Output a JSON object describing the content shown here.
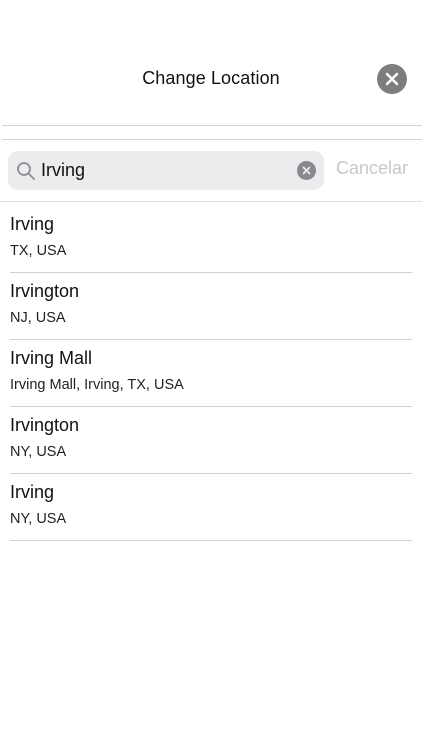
{
  "header": {
    "title": "Change Location"
  },
  "search": {
    "value": "Irving",
    "cancel_label": "Cancelar"
  },
  "results": [
    {
      "name": "Irving",
      "detail": "TX, USA"
    },
    {
      "name": "Irvington",
      "detail": "NJ, USA"
    },
    {
      "name": "Irving Mall",
      "detail": "Irving Mall, Irving, TX, USA"
    },
    {
      "name": "Irvington",
      "detail": "NY, USA"
    },
    {
      "name": "Irving",
      "detail": "NY, USA"
    }
  ],
  "icons": {
    "close": "close-icon",
    "search": "search-icon",
    "clear": "clear-icon"
  },
  "colors": {
    "close_button_bg": "#7d7d80",
    "search_bar_bg": "#ececee",
    "cancel_text": "#c7c7cc"
  }
}
